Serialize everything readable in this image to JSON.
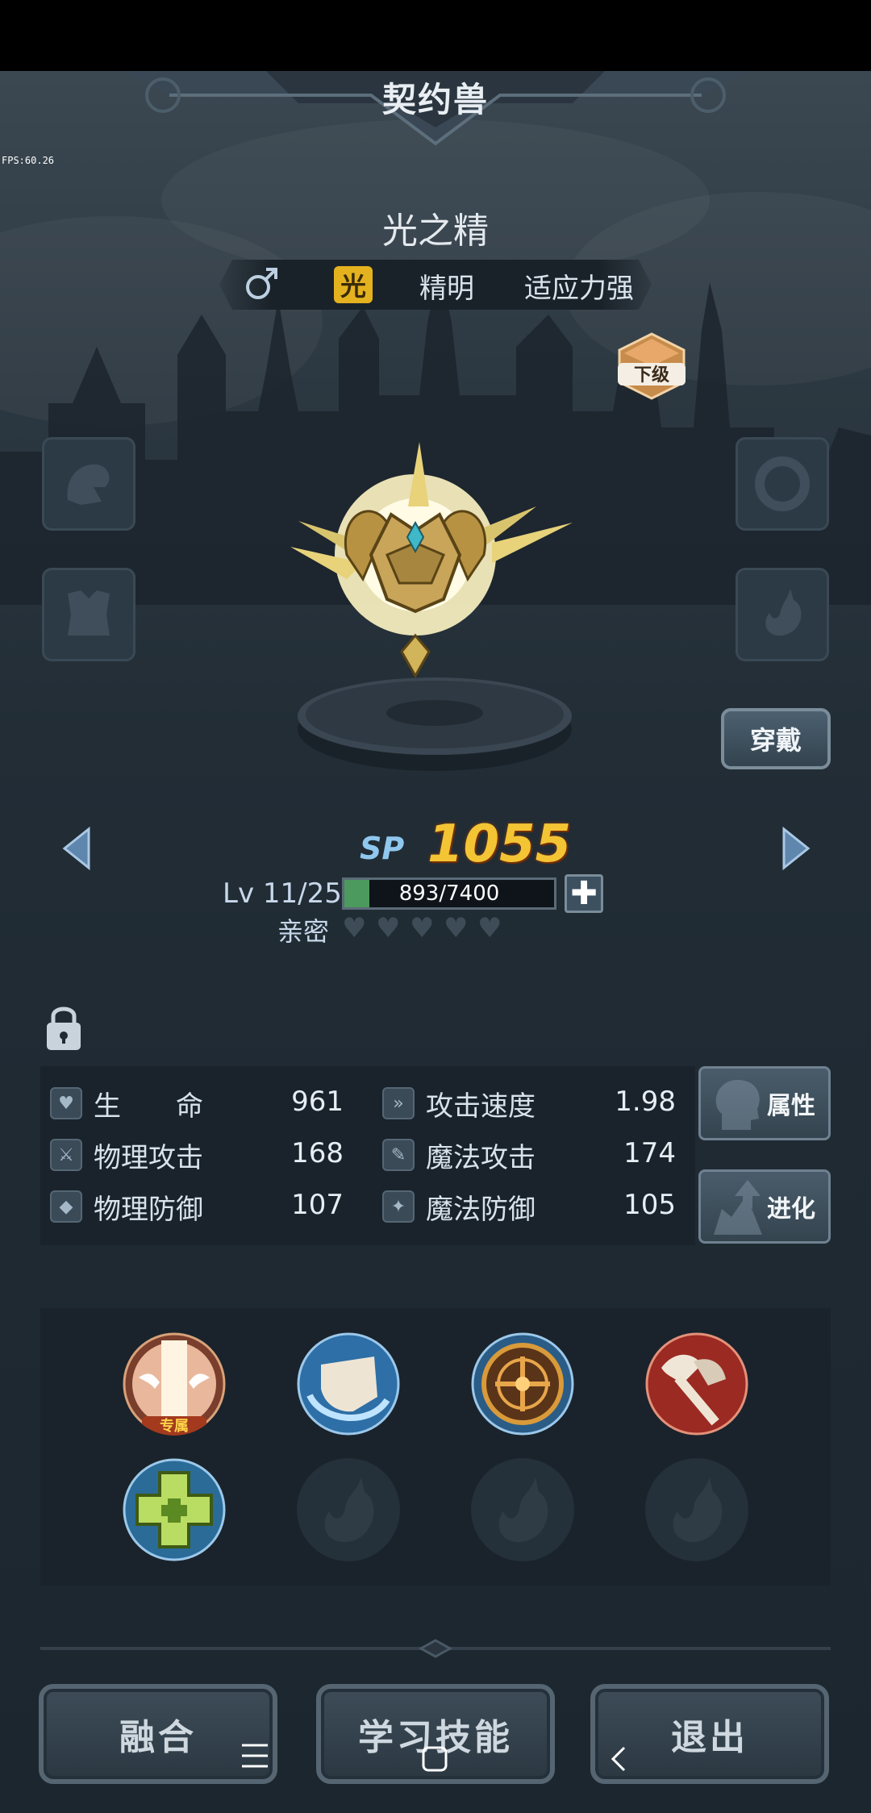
{
  "header": {
    "title": "契约兽",
    "fps": "FPS:60.26"
  },
  "beast": {
    "name": "光之精",
    "gender_symbol": "♂",
    "element": "光",
    "traits": [
      "精明",
      "适应力强"
    ],
    "grade_badge": "下级"
  },
  "actions": {
    "wear_label": "穿戴"
  },
  "sp": {
    "label": "SP",
    "value": "1055"
  },
  "level": {
    "text": "Lv 11/25",
    "exp_text": "893/7400",
    "exp_current": 893,
    "exp_max": 7400
  },
  "intimacy": {
    "label": "亲密",
    "hearts_filled": 0,
    "hearts_total": 5
  },
  "stats": [
    {
      "name": "生　　命",
      "value": "961",
      "icon": "heart-icon"
    },
    {
      "name": "攻击速度",
      "value": "1.98",
      "icon": "speed-icon"
    },
    {
      "name": "物理攻击",
      "value": "168",
      "icon": "sword-icon"
    },
    {
      "name": "魔法攻击",
      "value": "174",
      "icon": "wand-icon"
    },
    {
      "name": "物理防御",
      "value": "107",
      "icon": "shield-icon"
    },
    {
      "name": "魔法防御",
      "value": "105",
      "icon": "star-icon"
    }
  ],
  "side_buttons": {
    "attributes": "属性",
    "evolve": "进化"
  },
  "skills": {
    "exclusive_label": "专属",
    "slots": [
      "light-pillar-skill",
      "wind-slash-skill",
      "rune-circle-skill",
      "axe-strike-skill",
      "heal-skill",
      "empty",
      "empty",
      "empty"
    ]
  },
  "bottom": {
    "fuse": "融合",
    "learn": "学习技能",
    "exit": "退出"
  },
  "colors": {
    "accent": "#f3c535",
    "element_badge": "#e4b21f",
    "exp_fill": "#4c9a5e",
    "sp_label": "#8fc7ee"
  }
}
